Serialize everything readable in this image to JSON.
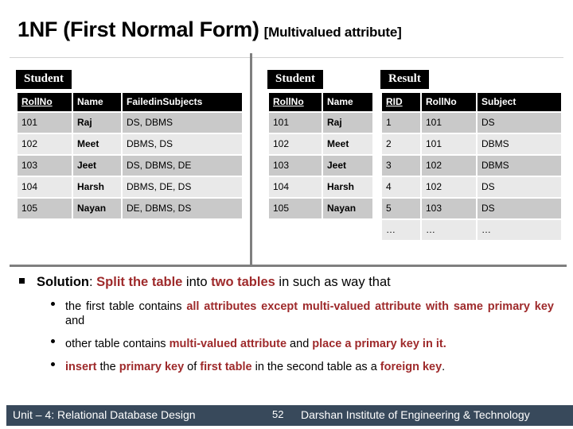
{
  "title": {
    "main": "1NF (First Normal Form)",
    "sub": "[Multivalued attribute]"
  },
  "tables": [
    {
      "caption": "Student",
      "columns": [
        "RollNo",
        "Name",
        "FailedinSubjects"
      ],
      "primary_key": "RollNo",
      "rows": [
        [
          "101",
          "Raj",
          "DS, DBMS"
        ],
        [
          "102",
          "Meet",
          "DBMS, DS"
        ],
        [
          "103",
          "Jeet",
          "DS, DBMS, DE"
        ],
        [
          "104",
          "Harsh",
          "DBMS, DE, DS"
        ],
        [
          "105",
          "Nayan",
          "DE, DBMS, DS"
        ]
      ]
    },
    {
      "caption": "Student",
      "columns": [
        "RollNo",
        "Name"
      ],
      "primary_key": "RollNo",
      "rows": [
        [
          "101",
          "Raj"
        ],
        [
          "102",
          "Meet"
        ],
        [
          "103",
          "Jeet"
        ],
        [
          "104",
          "Harsh"
        ],
        [
          "105",
          "Nayan"
        ]
      ]
    },
    {
      "caption": "Result",
      "columns": [
        "RID",
        "RollNo",
        "Subject"
      ],
      "primary_key": "RID",
      "rows": [
        [
          "1",
          "101",
          "DS"
        ],
        [
          "2",
          "101",
          "DBMS"
        ],
        [
          "3",
          "102",
          "DBMS"
        ],
        [
          "4",
          "102",
          "DS"
        ],
        [
          "5",
          "103",
          "DS"
        ],
        [
          "…",
          "…",
          "…"
        ]
      ]
    }
  ],
  "body": {
    "bullet1": {
      "lead": "Solution",
      "colon": ": ",
      "h1": "Split the table",
      "t1": " into ",
      "h2": "two tables",
      "t2": " in such as way that"
    },
    "bullet2": {
      "t1": "the first table contains ",
      "h1": "all attributes except multi-valued attribute with same primary key",
      "t2": " and"
    },
    "bullet3": {
      "t1": "other table contains ",
      "h1": "multi-valued attribute",
      "t2": " and ",
      "h2": "place a primary key in it."
    },
    "bullet4": {
      "h1": "insert",
      "t1": " the ",
      "h2": "primary key",
      "t2": " of ",
      "h3": "first table",
      "t3": " in the second table as a ",
      "h4": "foreign key",
      "t4": "."
    }
  },
  "footer": {
    "unit": "Unit – 4: Relational Database Design",
    "page": "52",
    "organization": "Darshan Institute of Engineering & Technology"
  },
  "colors": {
    "footer_bg": "#38495b",
    "highlight": "#9e2a2b",
    "header_bg": "#000000",
    "row_odd": "#c9c9c9",
    "row_even": "#e9e9e9",
    "divider": "#7f7f7f"
  }
}
